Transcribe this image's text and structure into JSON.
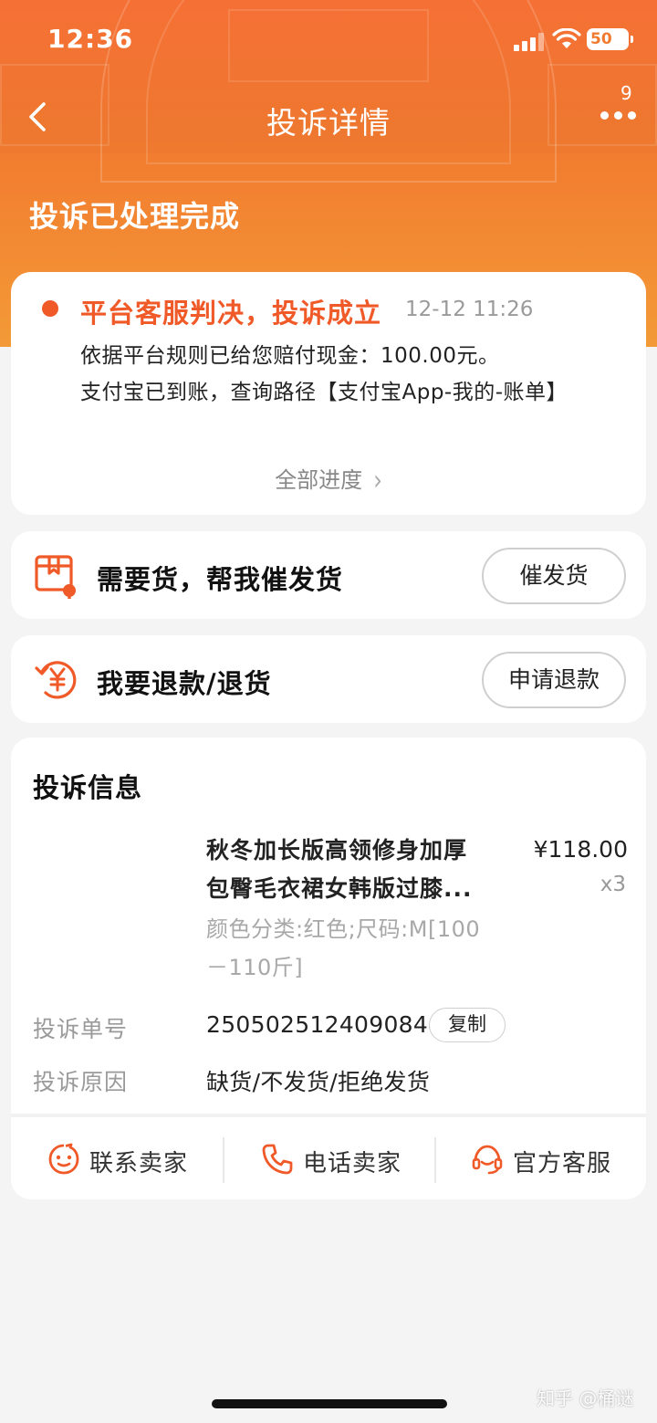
{
  "status_bar": {
    "time": "12:36",
    "battery": "50"
  },
  "nav": {
    "title": "投诉详情",
    "more_badge": "9"
  },
  "hero": {
    "status": "投诉已处理完成"
  },
  "progress": {
    "title": "平台客服判决，投诉成立",
    "time": "12-12 11:26",
    "line1": "依据平台规则已给您赔付现金：100.00元。",
    "line2": "支付宝已到账，查询路径【支付宝App-我的-账单】",
    "all_label": "全部进度"
  },
  "actions": [
    {
      "label": "需要货，帮我催发货",
      "button": "催发货"
    },
    {
      "label": "我要退款/退货",
      "button": "申请退款"
    }
  ],
  "info": {
    "title": "投诉信息",
    "product": {
      "name_line1": "秋冬加长版高领修身加厚",
      "name_line2": "包臀毛衣裙女韩版过膝...",
      "price": "¥118.00",
      "qty": "x3",
      "sku_line1": "颜色分类:红色;尺码:M[100",
      "sku_line2": "－110斤]"
    },
    "complaint_no_label": "投诉单号",
    "complaint_no": "2505025124090844",
    "copy_label": "复制",
    "reason_label": "投诉原因",
    "reason": "缺货/不发货/拒绝发货"
  },
  "contacts": [
    {
      "label": "联系卖家",
      "icon": "chat-face-icon"
    },
    {
      "label": "电话卖家",
      "icon": "phone-icon"
    },
    {
      "label": "官方客服",
      "icon": "headset-icon"
    }
  ],
  "colors": {
    "accent": "#f05a28",
    "hero_top": "#f56a2d",
    "hero_bottom": "#f39a37"
  },
  "watermark": "知乎 @桶谜"
}
